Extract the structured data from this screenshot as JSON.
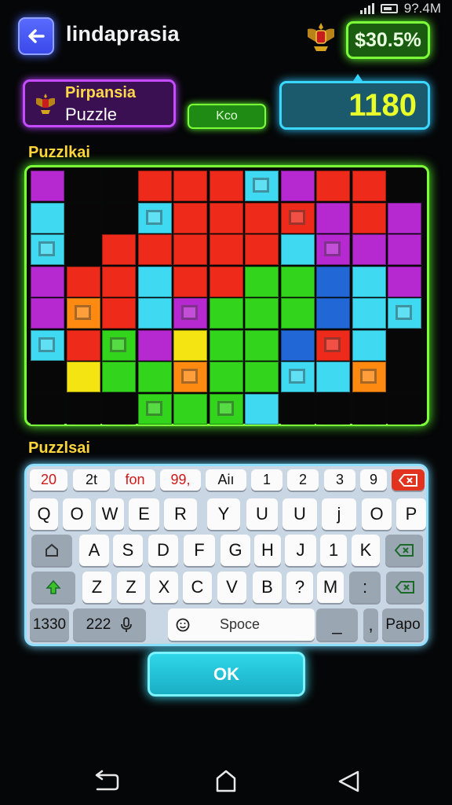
{
  "status": {
    "time": "9?.4M"
  },
  "header": {
    "title": "lindaprasia",
    "balance": "$30.5%"
  },
  "profile": {
    "name": "Pirpansia",
    "subtitle": "Puzzle"
  },
  "kco_label": "Kco",
  "score": "1180",
  "board_label": "Puzzlkai",
  "keyboard_label": "Puzzlsai",
  "colors": {
    "accent_green": "#7cff38",
    "accent_cyan": "#3ad8ff",
    "accent_purple": "#c54bff",
    "score_text": "#e9ff2a",
    "label_yellow": "#ffd63a"
  },
  "board": {
    "rows": [
      [
        "M",
        "K",
        "K",
        "R",
        "R",
        "R",
        "C*",
        "M",
        "R",
        "R",
        "K"
      ],
      [
        "C",
        "K",
        "K",
        "C*",
        "R",
        "R",
        "R",
        "R*",
        "M",
        "R",
        "M"
      ],
      [
        "C*",
        "K",
        "R",
        "R",
        "R",
        "R",
        "R",
        "C",
        "M*",
        "M",
        "M"
      ],
      [
        "M",
        "R",
        "R",
        "C",
        "R",
        "R",
        "G",
        "G",
        "B",
        "C",
        "M"
      ],
      [
        "M",
        "O*",
        "R",
        "C",
        "M*",
        "G",
        "G",
        "G",
        "B",
        "C",
        "C*"
      ],
      [
        "C*",
        "R",
        "G*",
        "M",
        "Y",
        "G",
        "G",
        "B",
        "R*",
        "C",
        "K"
      ],
      [
        "K",
        "Y",
        "G",
        "G",
        "O*",
        "G",
        "G",
        "C*",
        "C",
        "O*",
        "K"
      ],
      [
        "K",
        "K",
        "K",
        "G*",
        "G",
        "G*",
        "C",
        "K",
        "K",
        "K",
        "K"
      ]
    ],
    "palette": {
      "K": "#070707",
      "R": "#ee2a1b",
      "M": "#b629d0",
      "C": "#3fd9f2",
      "G": "#33d41c",
      "Y": "#f4e512",
      "O": "#ff8a12",
      "B": "#2167d6"
    }
  },
  "keyboard": {
    "rows": [
      [
        {
          "label": "20",
          "style": "top red-t"
        },
        {
          "label": "2t",
          "style": "top"
        },
        {
          "label": "fon",
          "style": "top red-t"
        },
        {
          "label": "99,",
          "style": "top red-t"
        },
        {
          "label": "Aiı",
          "style": "top"
        },
        {
          "label": "1",
          "style": "top"
        },
        {
          "label": "2",
          "style": "top"
        },
        {
          "label": "3",
          "style": "top"
        },
        {
          "label": "9",
          "style": "top"
        },
        {
          "label": "",
          "icon": "backspace-icon",
          "style": "top red"
        }
      ],
      [
        {
          "label": "Q"
        },
        {
          "label": "O"
        },
        {
          "label": "W"
        },
        {
          "label": "E"
        },
        {
          "label": "R"
        },
        {
          "label": "Y"
        },
        {
          "label": "U"
        },
        {
          "label": "U"
        },
        {
          "label": "j"
        },
        {
          "label": "O"
        },
        {
          "label": "P"
        }
      ],
      [
        {
          "label": "",
          "icon": "home-icon",
          "style": "gray"
        },
        {
          "label": "A"
        },
        {
          "label": "S"
        },
        {
          "label": "D"
        },
        {
          "label": "F"
        },
        {
          "label": "G"
        },
        {
          "label": "H"
        },
        {
          "label": "J"
        },
        {
          "label": "1"
        },
        {
          "label": "K"
        },
        {
          "label": "",
          "icon": "delete-icon",
          "style": "gray"
        }
      ],
      [
        {
          "label": "",
          "icon": "shift-icon",
          "style": "gray"
        },
        {
          "label": "Z"
        },
        {
          "label": "Z"
        },
        {
          "label": "X"
        },
        {
          "label": "C"
        },
        {
          "label": "V"
        },
        {
          "label": "B"
        },
        {
          "label": "?"
        },
        {
          "label": "M"
        },
        {
          "label": ":",
          "style": "gray"
        },
        {
          "label": "",
          "icon": "delete-icon",
          "style": "gray"
        }
      ],
      [
        {
          "label": "1330",
          "style": "gray"
        },
        {
          "label": "222",
          "icon": "mic-icon",
          "style": "gray"
        },
        {
          "label": "Spoce",
          "icon": "emoji-icon"
        },
        {
          "label": "_",
          "style": "gray"
        },
        {
          "label": ",",
          "style": "gray"
        },
        {
          "label": "Papo",
          "style": "gray"
        }
      ]
    ]
  },
  "ok_label": "OK",
  "navbar": {
    "items": [
      "back-nav-icon",
      "home-nav-icon",
      "recents-nav-icon"
    ]
  }
}
